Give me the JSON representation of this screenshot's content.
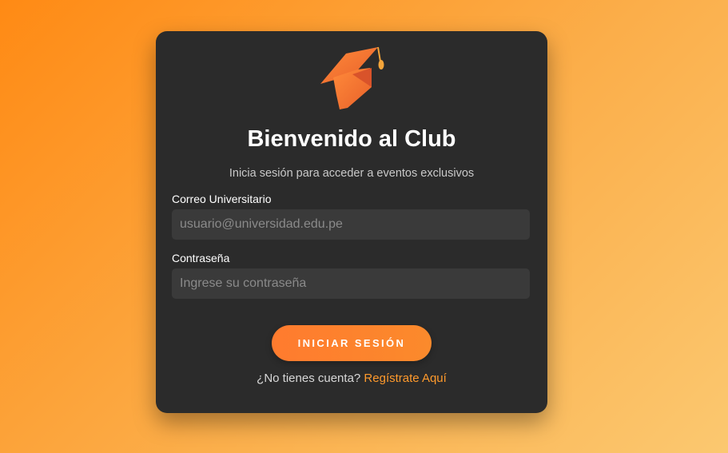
{
  "login": {
    "logo_icon": "graduation-cap-icon",
    "title": "Bienvenido al Club",
    "subtitle": "Inicia sesión para acceder a eventos exclusivos",
    "email": {
      "label": "Correo Universitario",
      "placeholder": "usuario@universidad.edu.pe",
      "value": ""
    },
    "password": {
      "label": "Contraseña",
      "placeholder": "Ingrese su contraseña",
      "value": ""
    },
    "submit_label": "INICIAR SESIÓN",
    "register_prompt": "¿No tienes cuenta?",
    "register_link": "Regístrate Aquí"
  },
  "colors": {
    "background_start": "#ff8a14",
    "background_end": "#fbc870",
    "card": "#2b2b2b",
    "input": "#3a3a3a",
    "accent": "#ff7b2e",
    "link": "#ff9a2c"
  }
}
